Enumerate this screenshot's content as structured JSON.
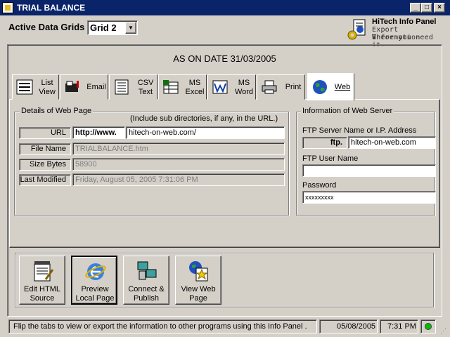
{
  "window": {
    "title": "TRIAL BALANCE",
    "minimize": "_",
    "maximize": "□",
    "close": "×"
  },
  "header": {
    "grids_label": "Active Data Grids",
    "grid_value": "Grid 2",
    "hitech_title": "HiTech Info Panel",
    "hitech_sub1": "Export Information",
    "hitech_sub2": "Where you need it."
  },
  "banner": {
    "date_text": "AS ON DATE 31/03/2005"
  },
  "tabs": [
    {
      "label1": "List",
      "label2": "View",
      "icon": "list-view-icon"
    },
    {
      "label1": "Email",
      "label2": "",
      "icon": "email-icon"
    },
    {
      "label1": "CSV",
      "label2": "Text",
      "icon": "csv-text-icon"
    },
    {
      "label1": "MS",
      "label2": "Excel",
      "icon": "excel-icon"
    },
    {
      "label1": "MS",
      "label2": "Word",
      "icon": "word-icon"
    },
    {
      "label1": "Print",
      "label2": "",
      "icon": "printer-icon"
    },
    {
      "label1": "Web",
      "label2": "",
      "icon": "globe-icon",
      "active": true
    }
  ],
  "web_page": {
    "legend": "Details of Web Page",
    "hint": "(Include sub directories, if any,  in the URL.)",
    "url_label": "URL",
    "url_prefix": "http://www.",
    "url_value": "hitech-on-web.com/",
    "file_name_label": "File Name",
    "file_name_value": "TRIALBALANCE.htm",
    "size_label": "Size Bytes",
    "size_value": "58900",
    "modified_label": "Last Modified",
    "modified_value": "Friday, August 05, 2005 7:31:06 PM"
  },
  "web_server": {
    "legend": "Information of Web Server",
    "ftp_label": "FTP Server Name or I.P. Address",
    "ftp_prefix": "ftp.",
    "ftp_value": "hitech-on-web.com",
    "user_label": "FTP User Name",
    "user_value": "",
    "password_label": "Password",
    "password_value": "xxxxxxxxx"
  },
  "buttons": [
    {
      "label1": "Edit HTML",
      "label2": "Source",
      "icon": "edit-html-icon"
    },
    {
      "label1": "Preview",
      "label2": "Local Page",
      "icon": "ie-globe-icon"
    },
    {
      "label1": "Connect &",
      "label2": "Publish",
      "icon": "network-computers-icon"
    },
    {
      "label1": "View Web",
      "label2": "Page",
      "icon": "web-page-star-icon"
    }
  ],
  "status": {
    "message": "Flip the tabs to view or export the information to other programs using this Info Panel .",
    "date": "05/08/2005",
    "time": "7:31 PM",
    "indicator_color": "#00c000"
  }
}
